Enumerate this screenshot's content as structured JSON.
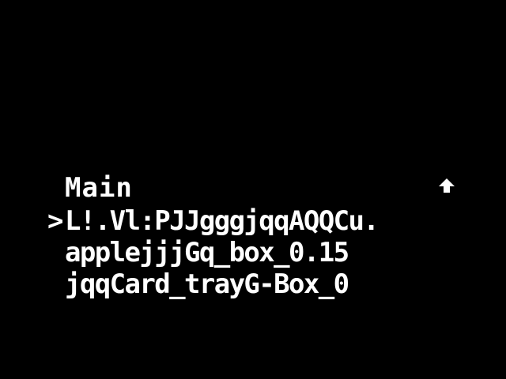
{
  "menu": {
    "title": "Main",
    "scroll_indicator": "up-arrow-icon",
    "cursor": ">",
    "items": [
      {
        "label": "L!.Vl:PJJgggjqqAQQCu.",
        "selected": true
      },
      {
        "label": "applejjjGq_box_0.15",
        "selected": false
      },
      {
        "label": "jqqCard_trayG-Box_0",
        "selected": false
      }
    ]
  },
  "colors": {
    "background": "#000000",
    "text": "#ffffff"
  }
}
